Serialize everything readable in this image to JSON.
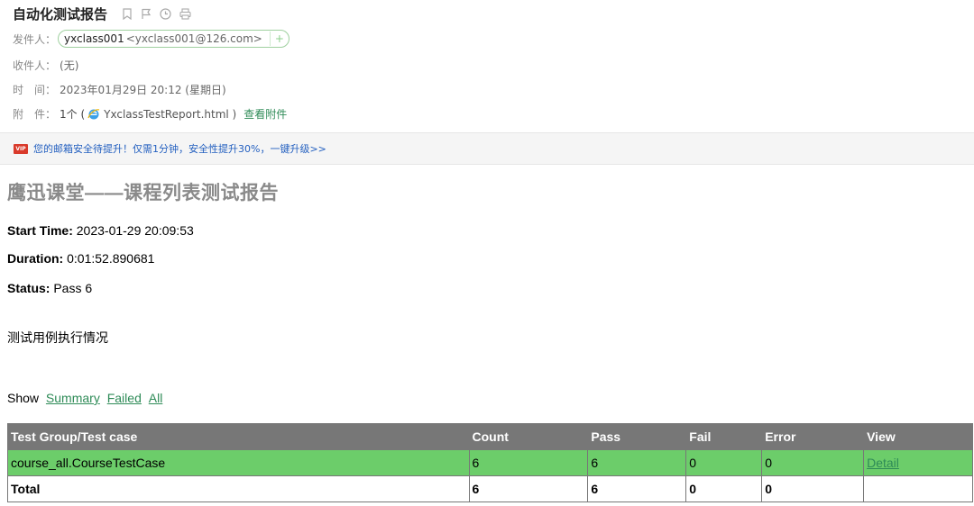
{
  "mail": {
    "subject": "自动化测试报告",
    "from_label": "发件人：",
    "sender_name": "yxclass001",
    "sender_email": "<yxclass001@126.com>",
    "add_symbol": "+",
    "to_label": "收件人：",
    "to_value": "(无)",
    "time_label": "时　间：",
    "time_value": "2023年01月29日 20:12 (星期日)",
    "attach_label": "附　件：",
    "attach_count": "1个 (",
    "attach_file": "YxclassTestReport.html )",
    "view_attach": "查看附件"
  },
  "banner": {
    "badge": "VIP",
    "text": "您的邮箱安全待提升！仅需1分钟，安全性提升30%，一键升级>>"
  },
  "report": {
    "title": "鹰迅课堂——课程列表测试报告",
    "start_label": "Start Time:",
    "start_value": " 2023-01-29 20:09:53",
    "duration_label": "Duration:",
    "duration_value": " 0:01:52.890681",
    "status_label": "Status:",
    "status_value": " Pass 6",
    "section_heading": "测试用例执行情况",
    "show_label": "Show",
    "show_links": [
      "Summary",
      "Failed",
      "All"
    ],
    "table": {
      "headers": [
        "Test Group/Test case",
        "Count",
        "Pass",
        "Fail",
        "Error",
        "View"
      ],
      "row": {
        "name": "course_all.CourseTestCase",
        "count": "6",
        "pass": "6",
        "fail": "0",
        "error": "0",
        "view": "Detail"
      },
      "total": {
        "name": "Total",
        "count": "6",
        "pass": "6",
        "fail": "0",
        "error": "0",
        "view": ""
      }
    }
  },
  "colors": {
    "pass_row": "#6ccd6a",
    "header_bg": "#777777",
    "link_green": "#2e8b57",
    "banner_link": "#2460c0",
    "vip_red": "#d93a2b"
  },
  "icons": [
    "bookmark-icon",
    "flag-icon",
    "clock-icon",
    "print-icon",
    "ie-file-icon",
    "vip-icon"
  ]
}
